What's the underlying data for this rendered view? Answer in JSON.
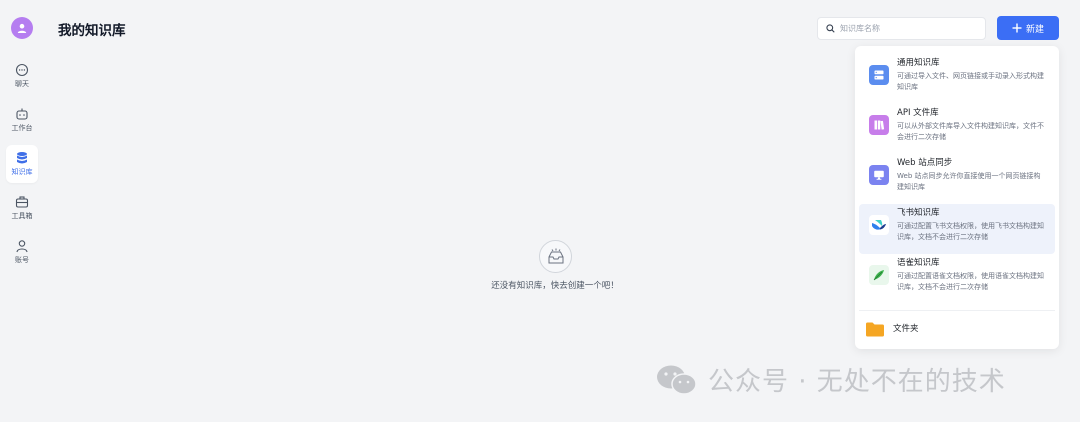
{
  "sidebar": {
    "items": [
      {
        "label": "聊天",
        "icon": "chat-icon"
      },
      {
        "label": "工作台",
        "icon": "robot-icon"
      },
      {
        "label": "知识库",
        "icon": "database-icon",
        "active": true
      },
      {
        "label": "工具箱",
        "icon": "toolbox-icon"
      },
      {
        "label": "账号",
        "icon": "user-icon"
      }
    ]
  },
  "header": {
    "title": "我的知识库",
    "search_placeholder": "知识库名称",
    "new_label": "新建"
  },
  "empty_state": {
    "text": "还没有知识库，快去创建一个吧！"
  },
  "dropdown": {
    "items": [
      {
        "title": "通用知识库",
        "desc": "可通过导入文件、网页链接或手动录入形式构建知识库",
        "color": "#5b8def"
      },
      {
        "title": "API 文件库",
        "desc": "可以从外部文件库导入文件构建知识库，文件不会进行二次存储",
        "color": "#c77dea"
      },
      {
        "title": "Web 站点同步",
        "desc": "Web 站点同步允许你直接使用一个网页链接构建知识库",
        "color": "#7b83f0"
      },
      {
        "title": "飞书知识库",
        "desc": "可通过配置飞书文档权限，使用飞书文档构建知识库，文档不会进行二次存储",
        "color": "#2f80ed"
      },
      {
        "title": "语雀知识库",
        "desc": "可通过配置语雀文档权限，使用语雀文档构建知识库，文档不会进行二次存储",
        "color": "#3fb34f"
      }
    ],
    "folder_label": "文件夹"
  },
  "watermark": {
    "text": "公众号 · 无处不在的技术"
  },
  "colors": {
    "accent": "#3b6ef5",
    "background": "#f3f4f6",
    "avatar": "#b57df0",
    "folder": "#f5a623"
  }
}
